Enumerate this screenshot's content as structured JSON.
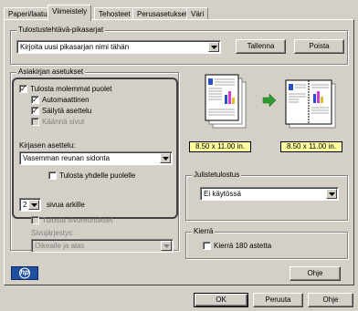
{
  "tabs": [
    {
      "label": "Paperi/laatu"
    },
    {
      "label": "Viimeistely"
    },
    {
      "label": "Tehosteet"
    },
    {
      "label": "Perusasetukset"
    },
    {
      "label": "Väri"
    }
  ],
  "quick_sets": {
    "group_label": "Tulostustehtävä-pikasarjat",
    "combo_value": "Kirjoita uusi pikasarjan nimi tähän",
    "save_label": "Tallenna",
    "delete_label": "Poista"
  },
  "doc_options": {
    "group_label": "Asiakirjan asetukset",
    "both_sides": {
      "label": "Tulosta molemmat puolet",
      "checked": true
    },
    "automatic": {
      "label": "Automaattinen",
      "checked": true
    },
    "keep_layout": {
      "label": "Säilytä asettelu",
      "checked": true
    },
    "flip_pages": {
      "label": "Käännä sivut",
      "checked": false
    },
    "binding_label": "Kirjasen asettelu:",
    "binding_value": "Vasemman reunan sidonta",
    "print_one_side": {
      "label": "Tulosta yhdelle puolelle",
      "checked": false
    },
    "pages_per_sheet_value": "2",
    "pages_per_sheet_label": "sivua arkille",
    "print_borders": {
      "label": "Tulosta sivureunukset",
      "checked": false
    },
    "page_order_label": "Sivujärjestys:",
    "page_order_value": "Oikealle ja alas"
  },
  "preview": {
    "size_left": "8.50 x 11.00 in.",
    "size_right": "8.50 x 11.00 in."
  },
  "poster": {
    "group_label": "Julistetulostus",
    "value": "Ei käytössä"
  },
  "rotate": {
    "group_label": "Kierrä",
    "checkbox": {
      "label": "Kierrä 180 astetta",
      "checked": false
    }
  },
  "logo_text": "hp",
  "help_label_panel": "Ohje",
  "footer": {
    "ok_label": "OK",
    "cancel_label": "Peruuta",
    "help_label": "Ohje"
  },
  "colors": {
    "accent_green": "#2f9a2f",
    "hp_blue": "#1e4fa0",
    "size_box": "#ffffa0"
  }
}
